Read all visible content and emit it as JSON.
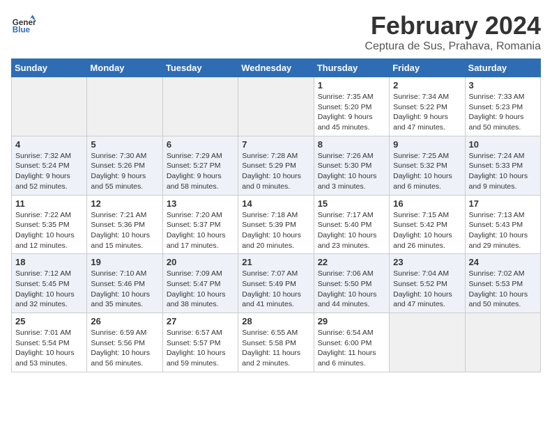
{
  "header": {
    "logo_general": "General",
    "logo_blue": "Blue",
    "title": "February 2024",
    "location": "Ceptura de Sus, Prahava, Romania"
  },
  "days_of_week": [
    "Sunday",
    "Monday",
    "Tuesday",
    "Wednesday",
    "Thursday",
    "Friday",
    "Saturday"
  ],
  "weeks": [
    [
      {
        "day": "",
        "info": ""
      },
      {
        "day": "",
        "info": ""
      },
      {
        "day": "",
        "info": ""
      },
      {
        "day": "",
        "info": ""
      },
      {
        "day": "1",
        "info": "Sunrise: 7:35 AM\nSunset: 5:20 PM\nDaylight: 9 hours and 45 minutes."
      },
      {
        "day": "2",
        "info": "Sunrise: 7:34 AM\nSunset: 5:22 PM\nDaylight: 9 hours and 47 minutes."
      },
      {
        "day": "3",
        "info": "Sunrise: 7:33 AM\nSunset: 5:23 PM\nDaylight: 9 hours and 50 minutes."
      }
    ],
    [
      {
        "day": "4",
        "info": "Sunrise: 7:32 AM\nSunset: 5:24 PM\nDaylight: 9 hours and 52 minutes."
      },
      {
        "day": "5",
        "info": "Sunrise: 7:30 AM\nSunset: 5:26 PM\nDaylight: 9 hours and 55 minutes."
      },
      {
        "day": "6",
        "info": "Sunrise: 7:29 AM\nSunset: 5:27 PM\nDaylight: 9 hours and 58 minutes."
      },
      {
        "day": "7",
        "info": "Sunrise: 7:28 AM\nSunset: 5:29 PM\nDaylight: 10 hours and 0 minutes."
      },
      {
        "day": "8",
        "info": "Sunrise: 7:26 AM\nSunset: 5:30 PM\nDaylight: 10 hours and 3 minutes."
      },
      {
        "day": "9",
        "info": "Sunrise: 7:25 AM\nSunset: 5:32 PM\nDaylight: 10 hours and 6 minutes."
      },
      {
        "day": "10",
        "info": "Sunrise: 7:24 AM\nSunset: 5:33 PM\nDaylight: 10 hours and 9 minutes."
      }
    ],
    [
      {
        "day": "11",
        "info": "Sunrise: 7:22 AM\nSunset: 5:35 PM\nDaylight: 10 hours and 12 minutes."
      },
      {
        "day": "12",
        "info": "Sunrise: 7:21 AM\nSunset: 5:36 PM\nDaylight: 10 hours and 15 minutes."
      },
      {
        "day": "13",
        "info": "Sunrise: 7:20 AM\nSunset: 5:37 PM\nDaylight: 10 hours and 17 minutes."
      },
      {
        "day": "14",
        "info": "Sunrise: 7:18 AM\nSunset: 5:39 PM\nDaylight: 10 hours and 20 minutes."
      },
      {
        "day": "15",
        "info": "Sunrise: 7:17 AM\nSunset: 5:40 PM\nDaylight: 10 hours and 23 minutes."
      },
      {
        "day": "16",
        "info": "Sunrise: 7:15 AM\nSunset: 5:42 PM\nDaylight: 10 hours and 26 minutes."
      },
      {
        "day": "17",
        "info": "Sunrise: 7:13 AM\nSunset: 5:43 PM\nDaylight: 10 hours and 29 minutes."
      }
    ],
    [
      {
        "day": "18",
        "info": "Sunrise: 7:12 AM\nSunset: 5:45 PM\nDaylight: 10 hours and 32 minutes."
      },
      {
        "day": "19",
        "info": "Sunrise: 7:10 AM\nSunset: 5:46 PM\nDaylight: 10 hours and 35 minutes."
      },
      {
        "day": "20",
        "info": "Sunrise: 7:09 AM\nSunset: 5:47 PM\nDaylight: 10 hours and 38 minutes."
      },
      {
        "day": "21",
        "info": "Sunrise: 7:07 AM\nSunset: 5:49 PM\nDaylight: 10 hours and 41 minutes."
      },
      {
        "day": "22",
        "info": "Sunrise: 7:06 AM\nSunset: 5:50 PM\nDaylight: 10 hours and 44 minutes."
      },
      {
        "day": "23",
        "info": "Sunrise: 7:04 AM\nSunset: 5:52 PM\nDaylight: 10 hours and 47 minutes."
      },
      {
        "day": "24",
        "info": "Sunrise: 7:02 AM\nSunset: 5:53 PM\nDaylight: 10 hours and 50 minutes."
      }
    ],
    [
      {
        "day": "25",
        "info": "Sunrise: 7:01 AM\nSunset: 5:54 PM\nDaylight: 10 hours and 53 minutes."
      },
      {
        "day": "26",
        "info": "Sunrise: 6:59 AM\nSunset: 5:56 PM\nDaylight: 10 hours and 56 minutes."
      },
      {
        "day": "27",
        "info": "Sunrise: 6:57 AM\nSunset: 5:57 PM\nDaylight: 10 hours and 59 minutes."
      },
      {
        "day": "28",
        "info": "Sunrise: 6:55 AM\nSunset: 5:58 PM\nDaylight: 11 hours and 2 minutes."
      },
      {
        "day": "29",
        "info": "Sunrise: 6:54 AM\nSunset: 6:00 PM\nDaylight: 11 hours and 6 minutes."
      },
      {
        "day": "",
        "info": ""
      },
      {
        "day": "",
        "info": ""
      }
    ]
  ]
}
